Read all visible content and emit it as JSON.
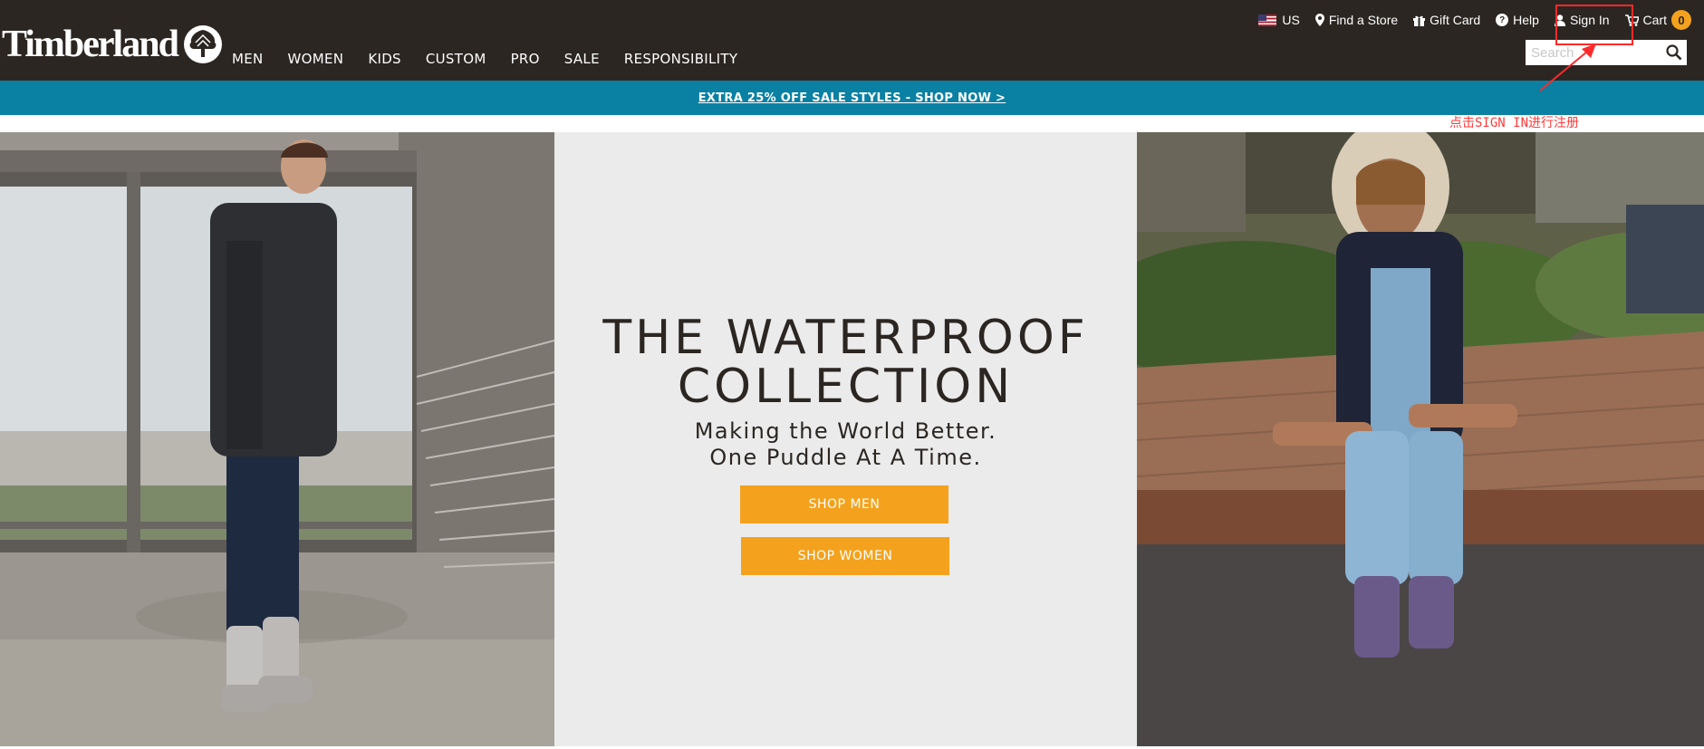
{
  "brand": {
    "name": "Timberland"
  },
  "nav": {
    "main": [
      "MEN",
      "WOMEN",
      "KIDS",
      "CUSTOM",
      "PRO",
      "SALE",
      "RESPONSIBILITY"
    ]
  },
  "utility": {
    "region": "US",
    "find_store": "Find a Store",
    "gift_card": "Gift Card",
    "help": "Help",
    "sign_in": "Sign In",
    "cart": "Cart",
    "cart_count": "0"
  },
  "search": {
    "placeholder": "Search"
  },
  "promo": {
    "text": "EXTRA 25% OFF SALE STYLES - SHOP NOW >"
  },
  "annotation": {
    "text": "点击SIGN IN进行注册"
  },
  "hero": {
    "title_line1": "THE WATERPROOF",
    "title_line2": "COLLECTION",
    "subtitle_line1": "Making the World Better.",
    "subtitle_line2": "One Puddle At A Time.",
    "cta_men": "SHOP MEN",
    "cta_women": "SHOP WOMEN"
  },
  "icons": {
    "flag": "us-flag-icon",
    "store": "map-pin-icon",
    "gift": "gift-icon",
    "help": "help-icon",
    "account": "user-icon",
    "cart": "cart-icon",
    "search": "search-icon"
  },
  "colors": {
    "header_bg": "#2b2622",
    "promo_bg": "#0a80a3",
    "accent": "#f4a21d",
    "panel_center_bg": "#ebebeb",
    "annotation": "#ff2a2a"
  }
}
